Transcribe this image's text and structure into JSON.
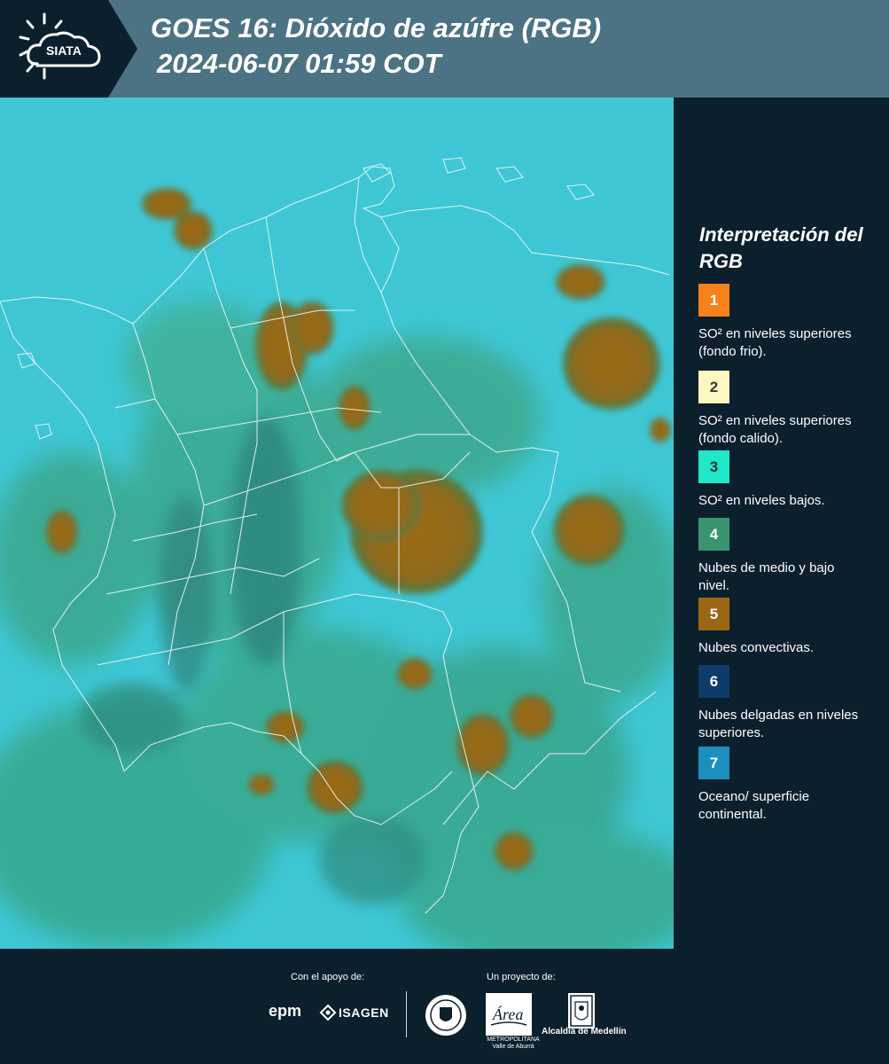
{
  "header": {
    "logo_text": "SIATA",
    "title": "GOES 16: Dióxido de azúfre (RGB)",
    "timestamp": "2024-06-07 01:59 COT"
  },
  "legend": {
    "title": "Interpretación del RGB",
    "items": [
      {
        "number": "1",
        "color": "#f7821b",
        "text_color": "#ffffff",
        "label": "SO² en niveles superiores (fondo frio)."
      },
      {
        "number": "2",
        "color": "#fff7c2",
        "text_color": "#333333",
        "label": "SO² en niveles superiores (fondo calido)."
      },
      {
        "number": "3",
        "color": "#1ee8c8",
        "text_color": "#333333",
        "label": "SO² en niveles bajos."
      },
      {
        "number": "4",
        "color": "#3a9470",
        "text_color": "#ffffff",
        "label": "Nubes de medio y bajo nivel."
      },
      {
        "number": "5",
        "color": "#9a6614",
        "text_color": "#ffffff",
        "label": "Nubes convectivas."
      },
      {
        "number": "6",
        "color": "#0d3b6b",
        "text_color": "#ffffff",
        "label": "Nubes delgadas en niveles superiores."
      },
      {
        "number": "7",
        "color": "#1b8fc0",
        "text_color": "#ffffff",
        "label": "Oceano/ superficie continental."
      }
    ]
  },
  "footer": {
    "support_caption": "Con el apoyo de:",
    "project_caption": "Un proyecto de:",
    "epm": "epm",
    "isagen": "ISAGEN",
    "area_text": "METROPOLITANA Valle de Aburrá",
    "area_script": "Área",
    "alcaldia": "Alcaldía de Medellín"
  },
  "colors": {
    "header_bg": "#4b7383",
    "panel_bg": "#0b1f2d",
    "ocean_cyan": "#3fc7d6",
    "convective": "#9a6614"
  }
}
